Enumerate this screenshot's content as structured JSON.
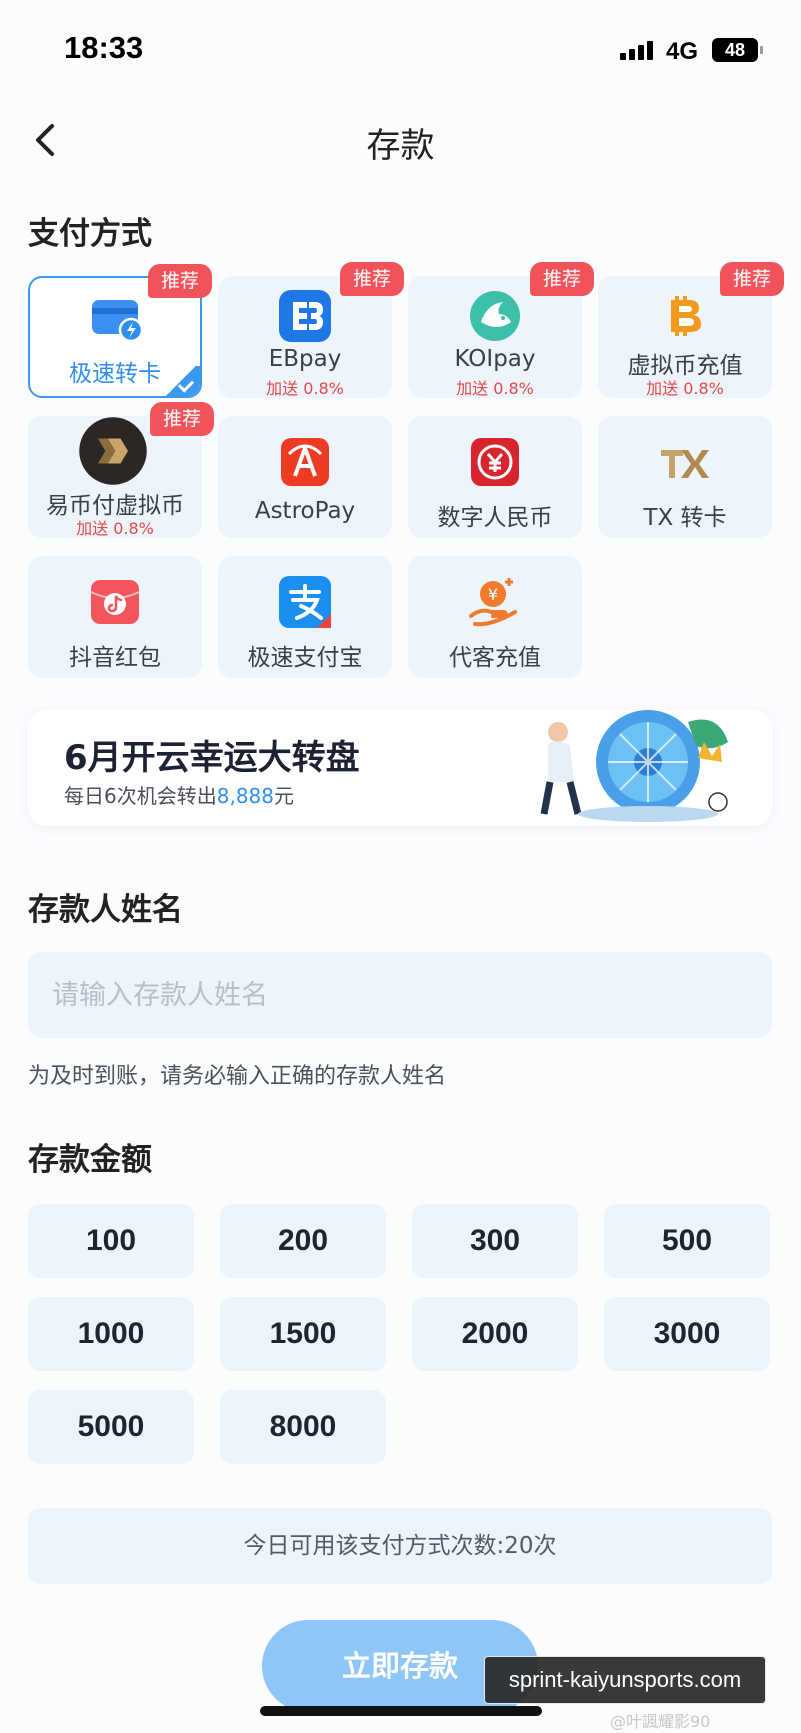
{
  "status_bar": {
    "time": "18:33",
    "network": "4G",
    "battery": "48"
  },
  "nav": {
    "title": "存款"
  },
  "payment": {
    "section_title": "支付方式",
    "methods": [
      {
        "label": "极速转卡",
        "icon": "card-flash-icon",
        "tag": "推荐",
        "selected": true
      },
      {
        "label": "EBpay",
        "icon": "ebpay-logo-icon",
        "tag": "推荐",
        "bonus": "加送 0.8%"
      },
      {
        "label": "KOIpay",
        "icon": "koi-fish-icon",
        "tag": "推荐",
        "bonus": "加送 0.8%"
      },
      {
        "label": "虚拟币充值",
        "icon": "bitcoin-icon",
        "tag": "推荐",
        "bonus": "加送 0.8%"
      },
      {
        "label": "易币付虚拟币",
        "icon": "yibifu-logo-icon",
        "tag": "推荐",
        "bonus": "加送 0.8%"
      },
      {
        "label": "AstroPay",
        "icon": "astropay-logo-icon"
      },
      {
        "label": "数字人民币",
        "icon": "digital-rmb-icon"
      },
      {
        "label": "TX 转卡",
        "icon": "tx-logo-icon"
      },
      {
        "label": "抖音红包",
        "icon": "douyin-redpacket-icon"
      },
      {
        "label": "极速支付宝",
        "icon": "alipay-icon"
      },
      {
        "label": "代客充值",
        "icon": "agent-recharge-icon"
      }
    ]
  },
  "banner": {
    "title": "6月开云幸运大转盘",
    "sub_prefix": "每日6次机会转出",
    "sub_amount": "8,888",
    "sub_suffix": "元"
  },
  "depositor": {
    "section_title": "存款人姓名",
    "placeholder": "请输入存款人姓名",
    "hint": "为及时到账，请务必输入正确的存款人姓名"
  },
  "amount": {
    "section_title": "存款金额",
    "options": [
      "100",
      "200",
      "300",
      "500",
      "1000",
      "1500",
      "2000",
      "3000",
      "5000",
      "8000"
    ]
  },
  "usage": "今日可用该支付方式次数:20次",
  "submit_label": "立即存款",
  "watermark": "sprint-kaiyunsports.com",
  "credit": "@叶諷耀影90",
  "colors": {
    "accent": "#2f8ff0",
    "tag": "#f0535a",
    "card_bg": "#eef4fb",
    "submit": "#8ec6f8"
  }
}
